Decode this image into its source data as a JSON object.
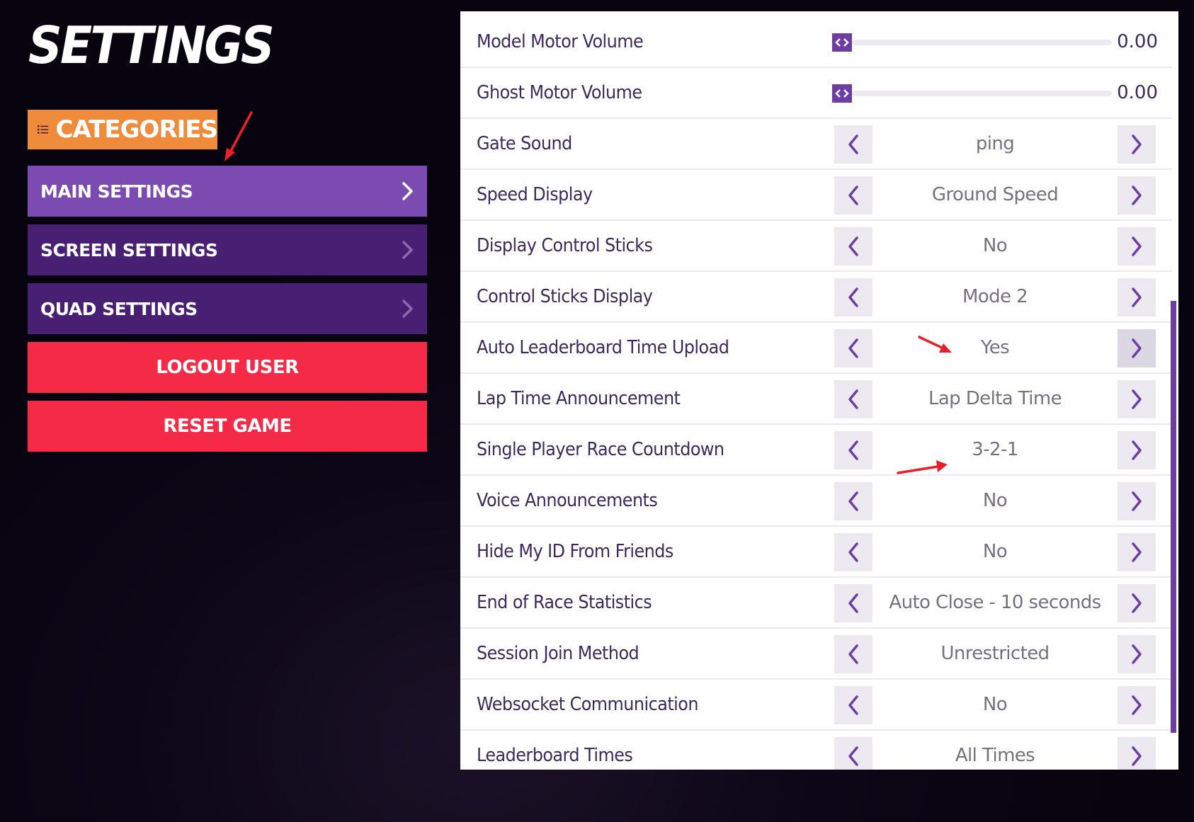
{
  "page_title": "SETTINGS",
  "categories_label": "CATEGORIES",
  "menu": [
    {
      "label": "MAIN SETTINGS",
      "active": true
    },
    {
      "label": "SCREEN SETTINGS",
      "active": false
    },
    {
      "label": "QUAD SETTINGS",
      "active": false
    }
  ],
  "logout_label": "LOGOUT USER",
  "reset_label": "RESET GAME",
  "sliders": [
    {
      "label": "Model Motor Volume",
      "value": "0.00"
    },
    {
      "label": "Ghost Motor Volume",
      "value": "0.00"
    }
  ],
  "options": [
    {
      "label": "Gate Sound",
      "value": "ping"
    },
    {
      "label": "Speed Display",
      "value": "Ground Speed"
    },
    {
      "label": "Display Control Sticks",
      "value": "No"
    },
    {
      "label": "Control Sticks Display",
      "value": "Mode 2"
    },
    {
      "label": "Auto Leaderboard Time Upload",
      "value": "Yes"
    },
    {
      "label": "Lap Time Announcement",
      "value": "Lap Delta Time"
    },
    {
      "label": "Single Player Race Countdown",
      "value": "3-2-1"
    },
    {
      "label": "Voice Announcements",
      "value": "No"
    },
    {
      "label": "Hide My ID From Friends",
      "value": "No"
    },
    {
      "label": "End of Race Statistics",
      "value": "Auto Close - 10 seconds"
    },
    {
      "label": "Session Join Method",
      "value": "Unrestricted"
    },
    {
      "label": "Websocket Communication",
      "value": "No"
    },
    {
      "label": "Leaderboard Times",
      "value": "All Times"
    }
  ],
  "colors": {
    "accent_purple": "#7b4bb1",
    "inactive_purple": "#482073",
    "danger_red": "#f52a47",
    "category_orange": "#ef8b3a",
    "annotation_red": "#e8202a"
  }
}
